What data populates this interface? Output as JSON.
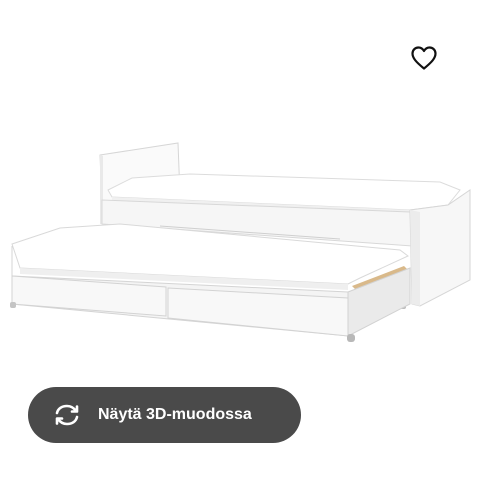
{
  "product": {
    "image_alt": "White single bed frame with pull-out bed and two storage drawers"
  },
  "favorite": {
    "icon": "heart-outline-icon"
  },
  "view_3d_button": {
    "label": "Näytä 3D-muodossa",
    "icon": "rotate-arrows-icon",
    "background": "#4a4a4a",
    "text_color": "#ffffff"
  }
}
